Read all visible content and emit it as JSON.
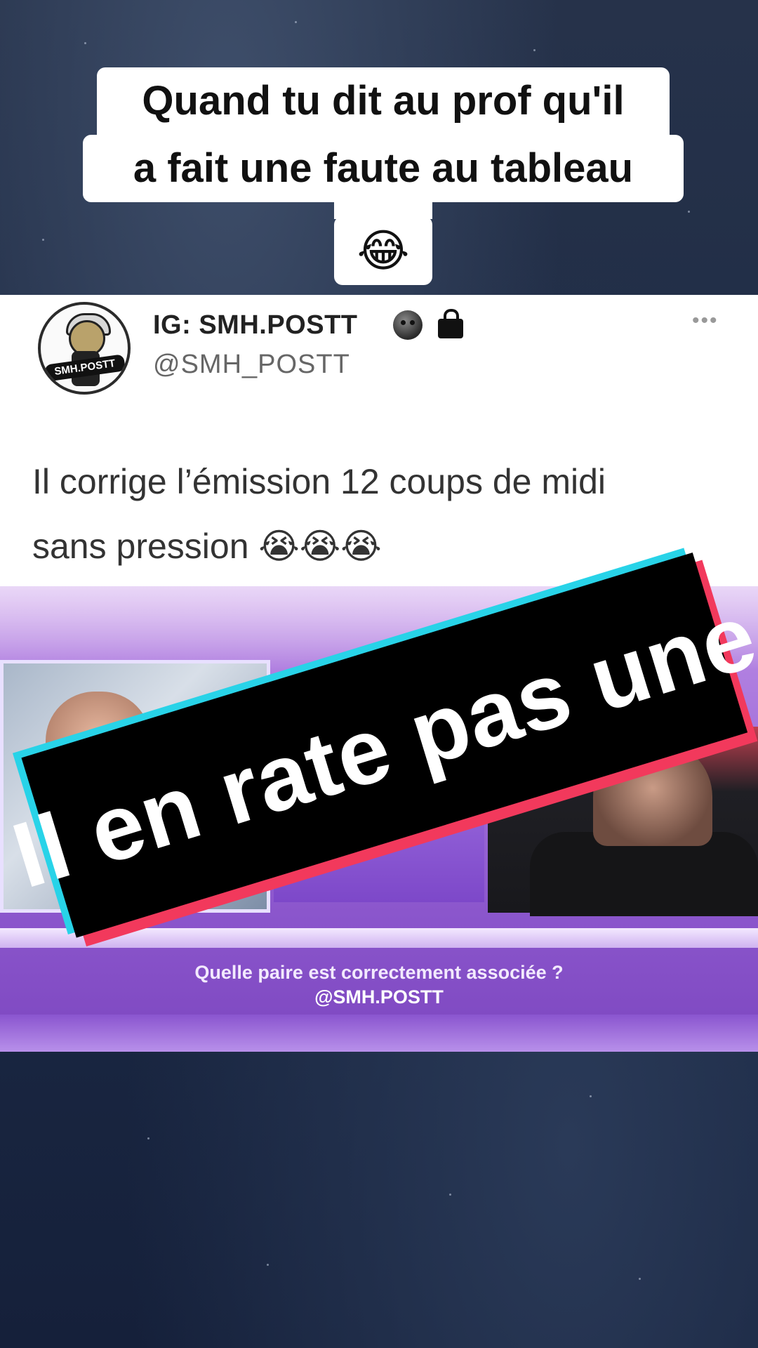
{
  "caption": {
    "line1": "Quand tu dit au prof qu'il",
    "line2": "a fait une faute au tableau",
    "emoji": "😂"
  },
  "tweet": {
    "avatar_text": "SMH.POSTT",
    "name": "IG: SMH.POSTT",
    "name_icon_1": "dark-face-emoji-icon",
    "name_icon_2": "lock-icon",
    "handle": "@SMH_POSTT",
    "more": "•••",
    "text_line1": "Il corrige l’émission 12 coups de midi",
    "text_line2": "sans pression 😭😭😭"
  },
  "video": {
    "question": "Quelle paire est correctement associée ?",
    "watermark": "@SMH.POSTT"
  },
  "banner": {
    "text": "Il en rate pas une",
    "colors": {
      "cyan": "#28d3e8",
      "red": "#f2395c",
      "black": "#000000"
    }
  }
}
